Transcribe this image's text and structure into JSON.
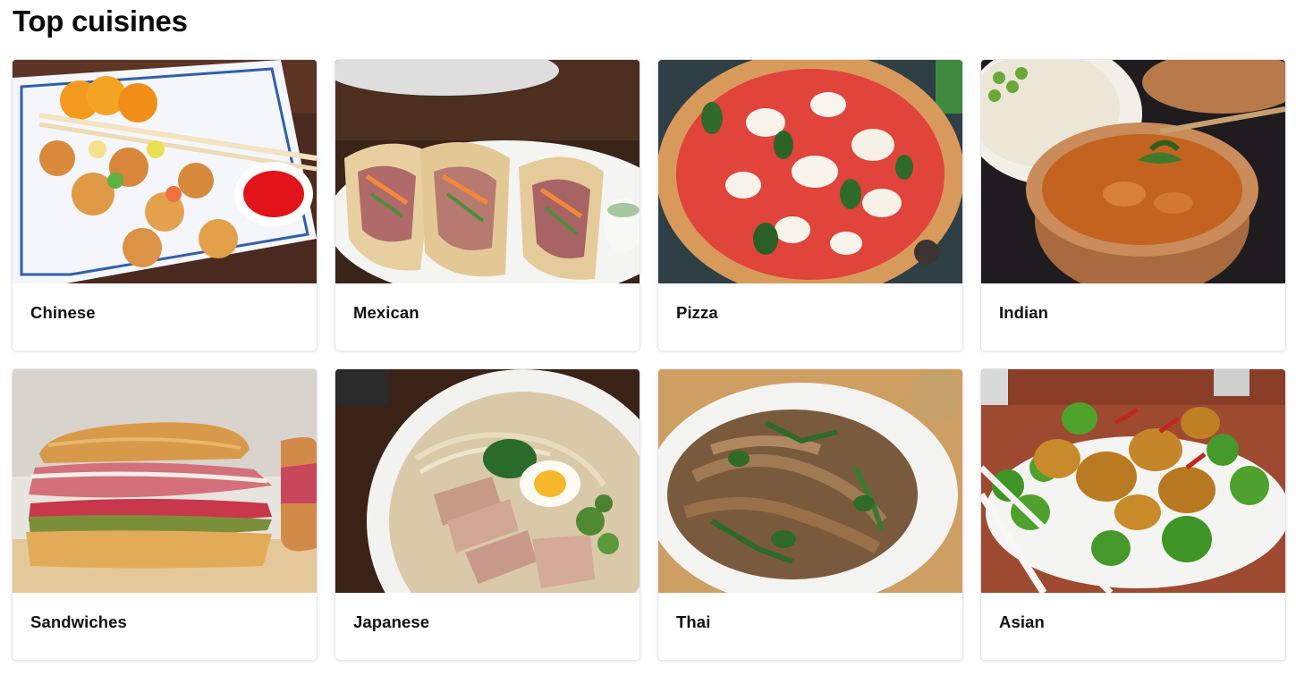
{
  "section": {
    "title": "Top cuisines"
  },
  "cuisines": [
    {
      "label": "Chinese",
      "photo": "chinese-sweet-sour-photo"
    },
    {
      "label": "Mexican",
      "photo": "mexican-tacos-photo"
    },
    {
      "label": "Pizza",
      "photo": "pizza-margherita-photo"
    },
    {
      "label": "Indian",
      "photo": "indian-curry-photo"
    },
    {
      "label": "Sandwiches",
      "photo": "sub-sandwich-photo"
    },
    {
      "label": "Japanese",
      "photo": "ramen-bowl-photo"
    },
    {
      "label": "Thai",
      "photo": "thai-noodles-photo"
    },
    {
      "label": "Asian",
      "photo": "orange-chicken-broccoli-photo"
    }
  ]
}
